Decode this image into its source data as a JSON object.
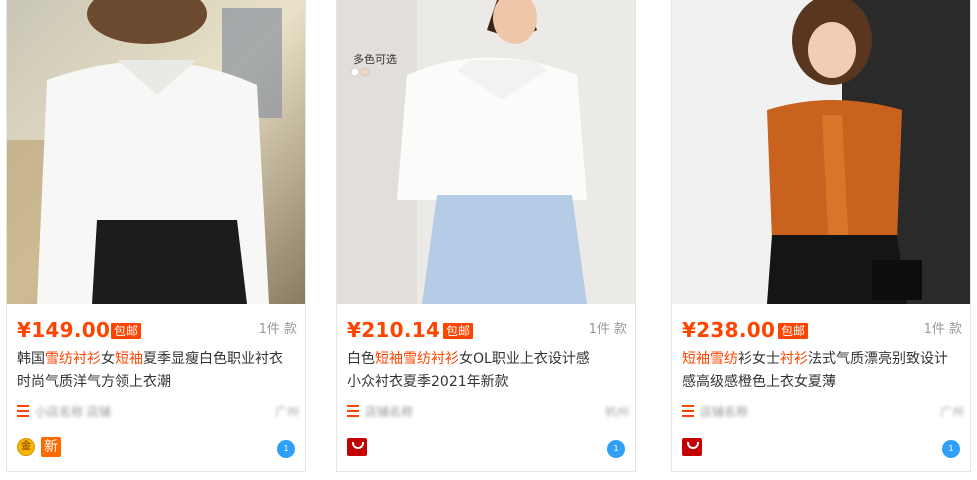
{
  "products": [
    {
      "price": "¥149.00",
      "shipping_tag": "包邮",
      "sold": "1件 款",
      "title_parts": [
        "韩国",
        "雪纺衬衫",
        "女",
        "短袖",
        "夏季显瘦白色职业衬衣",
        "时尚气质洋气方领上衣潮"
      ],
      "shop": "小店名称 店铺",
      "location": "广州",
      "badge": "新"
    },
    {
      "price": "¥210.14",
      "shipping_tag": "包邮",
      "sold": "1件 款",
      "image_text": "多色可选",
      "title_parts": [
        "白色",
        "短袖雪纺衬衫",
        "女OL职业上衣设计感",
        "小众衬衣夏季2021年新款"
      ],
      "shop": "店铺名称",
      "location": "杭州"
    },
    {
      "price": "¥238.00",
      "shipping_tag": "包邮",
      "sold": "1件 款",
      "title_parts": [
        "短袖雪纺",
        "衫女士",
        "衬衫",
        "法式气质漂亮别致设计",
        "感高级感橙色上衣女夏薄"
      ],
      "shop": "店铺名称",
      "location": "广州"
    }
  ],
  "icons": {
    "shop": "shop-icon",
    "chat": "chat-icon",
    "gold": "gold-medal-icon",
    "tmall": "tmall-icon"
  },
  "colors": {
    "accent": "#ff4400",
    "chat": "#2fa0f5",
    "tmall": "#c40000"
  }
}
